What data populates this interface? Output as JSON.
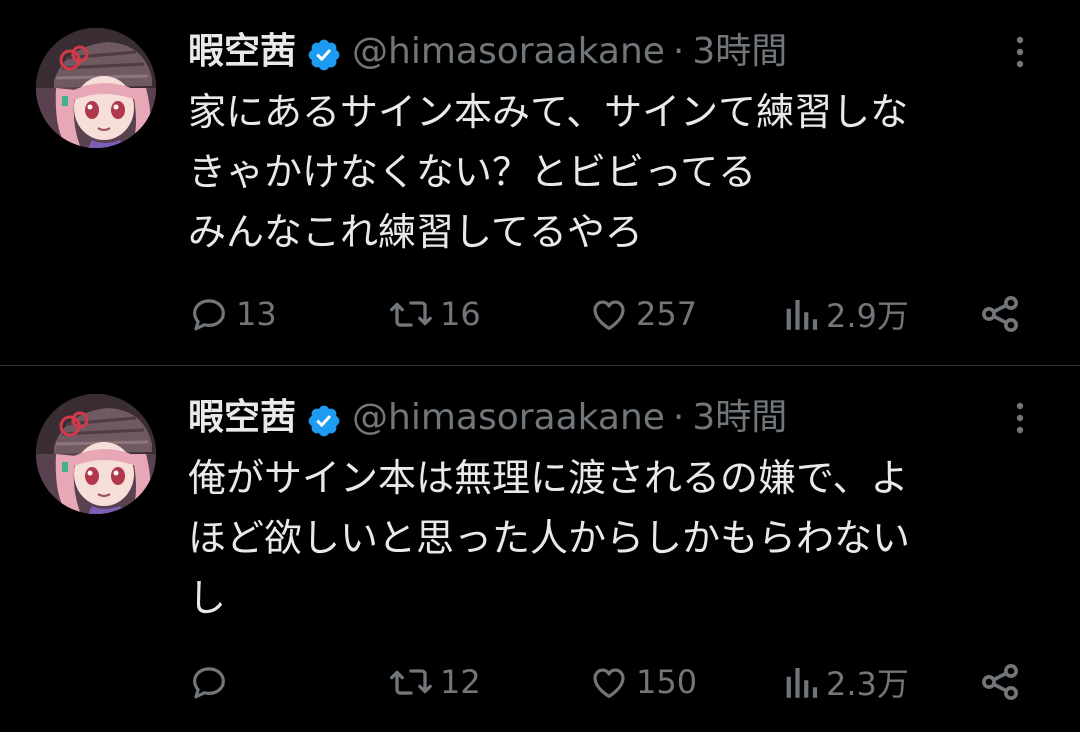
{
  "tweets": [
    {
      "display_name": "暇空茜",
      "handle": "@himasoraakane",
      "separator": "·",
      "time": "3時間",
      "lines": [
        "家にあるサイン本みて、サインて練習しな",
        "きゃかけなくない？とビビってる",
        "みんなこれ練習してるやろ"
      ],
      "stats": {
        "replies": "13",
        "retweets": "16",
        "likes": "257",
        "views": "2.9万"
      }
    },
    {
      "display_name": "暇空茜",
      "handle": "@himasoraakane",
      "separator": "·",
      "time": "3時間",
      "lines": [
        "俺がサイン本は無理に渡されるの嫌で、よ",
        "ほど欲しいと思った人からしかもらわない",
        "し"
      ],
      "stats": {
        "replies": "",
        "retweets": "12",
        "likes": "150",
        "views": "2.3万"
      }
    }
  ],
  "colors": {
    "background": "#000000",
    "text": "#e7e9ea",
    "secondary": "#71767b",
    "verified_badge": "#1d9bf0",
    "divider": "#2f3336"
  },
  "icons": [
    "reply-icon",
    "retweet-icon",
    "like-icon",
    "views-icon",
    "share-icon",
    "more-icon",
    "verified-badge-icon"
  ]
}
